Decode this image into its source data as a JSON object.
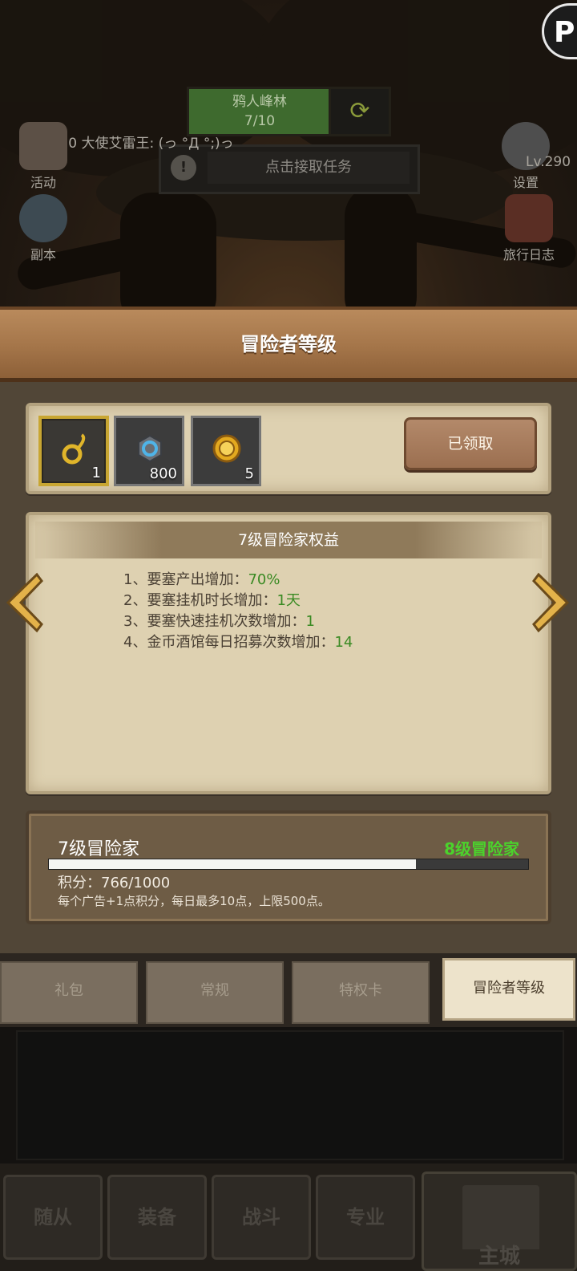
{
  "scene": {
    "quest_name": "鸦人峰林",
    "quest_progress": "7/10",
    "chat_line": "Lv.290 大使艾雷王: (っ °Д °;)っ",
    "task_prompt": "点击接取任务",
    "left_buttons": [
      "活动",
      "副本"
    ],
    "right_buttons": [
      "设置",
      "旅行日志"
    ],
    "level_badge": "Lv.290",
    "logo_letter": "P"
  },
  "header": {
    "title": "冒险者等级"
  },
  "rewards": {
    "items": [
      {
        "icon": "gold-ring-icon",
        "count": "1",
        "highlight": true
      },
      {
        "icon": "blue-gem-icon",
        "count": "800",
        "highlight": false
      },
      {
        "icon": "gold-medal-icon",
        "count": "5",
        "highlight": false
      }
    ],
    "claim_label": "已领取"
  },
  "benefits": {
    "title": "7级冒险家权益",
    "lines": [
      {
        "text": "1、要塞产出增加：",
        "value": "70%"
      },
      {
        "text": "2、要塞挂机时长增加：",
        "value": "1天"
      },
      {
        "text": "3、要塞快速挂机次数增加：",
        "value": "1"
      },
      {
        "text": "4、金币酒馆每日招募次数增加：",
        "value": "14"
      }
    ]
  },
  "progress": {
    "current_level": "7级冒险家",
    "next_level": "8级冒险家",
    "points_text": "积分：766/1000",
    "fill_fraction": 0.766,
    "note": "每个广告+1点积分，每日最多10点，上限500点。"
  },
  "tabs": [
    {
      "label": "礼包",
      "active": false
    },
    {
      "label": "常规",
      "active": false
    },
    {
      "label": "特权卡",
      "active": false
    },
    {
      "label": "冒险者等级",
      "active": true
    }
  ],
  "bottom_nav": [
    "随从",
    "装备",
    "战斗",
    "专业"
  ],
  "bottom_main": "主城",
  "colors": {
    "accent_green": "#3a8a23",
    "next_level_green": "#4bd32c",
    "gold": "#c8a632"
  }
}
